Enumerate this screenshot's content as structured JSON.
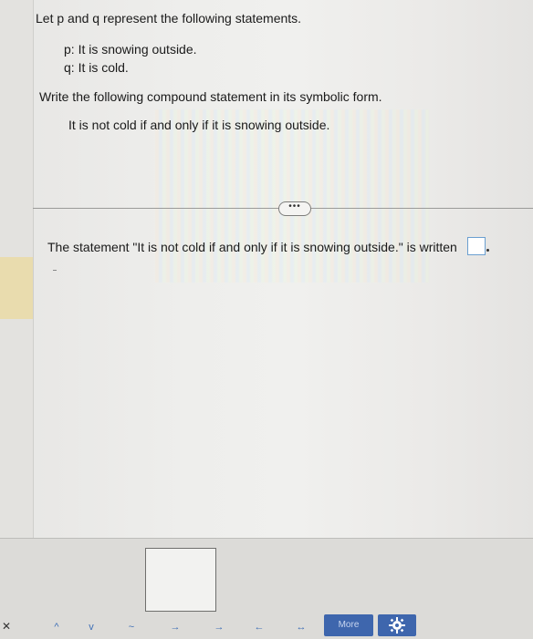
{
  "question": {
    "intro": "Let p and q represent the following statements.",
    "statements": [
      "p: It is snowing outside.",
      "q: It is cold."
    ],
    "instruction": "Write the following compound statement in its symbolic form.",
    "compound_statement": "It is not cold if and only if it is snowing outside."
  },
  "divider": {
    "more_label": "•••"
  },
  "answer": {
    "prompt": "The statement \"It is not cold if and only if it is snowing outside.\" is written"
  },
  "toolbar": {
    "symbols": [
      "^",
      "v",
      "~",
      "→",
      "→",
      "←",
      "↔"
    ],
    "more_label": "More"
  },
  "colors": {
    "accent": "#3e66ad",
    "answer_box_border": "#6a9fd0"
  },
  "icons": {
    "settings": "gear-icon",
    "close": "close-icon"
  }
}
